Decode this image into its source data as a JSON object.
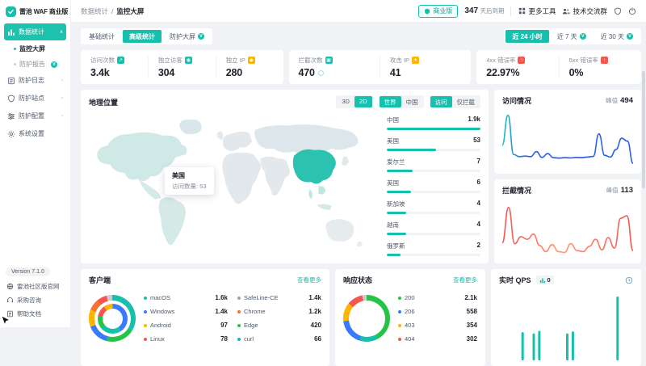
{
  "app": {
    "logo_text": "雷池 WAF 商业版",
    "version": "Version 7.1.0"
  },
  "sidebar": {
    "menu": [
      {
        "key": "data-stats",
        "label": "数据统计",
        "icon": "chart-icon",
        "active": true,
        "children": [
          {
            "key": "monitor-screen",
            "label": "监控大屏",
            "current": true
          },
          {
            "key": "protect-report",
            "label": "防护报告",
            "vip": true
          }
        ]
      },
      {
        "key": "protect-logs",
        "label": "防护日志",
        "icon": "log-icon",
        "chevron": true
      },
      {
        "key": "protect-sites",
        "label": "防护站点",
        "icon": "site-icon",
        "chevron": true
      },
      {
        "key": "protect-config",
        "label": "防护配置",
        "icon": "config-icon",
        "chevron": true
      },
      {
        "key": "system-settings",
        "label": "系统设置",
        "icon": "gear-icon"
      }
    ],
    "links": [
      {
        "key": "community-site",
        "label": "雷池社区版官网",
        "icon": "globe-icon"
      },
      {
        "key": "purchase",
        "label": "采购咨询",
        "icon": "headset-icon"
      },
      {
        "key": "help-docs",
        "label": "帮助文档",
        "icon": "doc-icon"
      }
    ]
  },
  "header": {
    "breadcrumb_parent": "数据统计",
    "breadcrumb_sep": "/",
    "breadcrumb_current": "监控大屏",
    "edition": "商业版",
    "expiry_days": "347",
    "expiry_suffix": "天后到期",
    "more_tools": "更多工具",
    "tech_group": "技术交流群"
  },
  "toolbar": {
    "tabs": [
      {
        "key": "basic-stats",
        "label": "基础统计"
      },
      {
        "key": "advanced-stats",
        "label": "高级统计",
        "active": true
      },
      {
        "key": "protect-screen",
        "label": "防护大屏",
        "vip": true
      }
    ],
    "ranges": [
      {
        "key": "24h",
        "label": "近 24 小时",
        "active": true
      },
      {
        "key": "7d",
        "label": "近 7 天",
        "vip": true
      },
      {
        "key": "30d",
        "label": "近 30 天",
        "vip": true
      }
    ]
  },
  "stats_cards": [
    {
      "items": [
        {
          "key": "visits",
          "label": "访问次数",
          "value": "3.4k",
          "icon_color": "#16c0ac",
          "glyph": "↗"
        },
        {
          "key": "unique-visitors",
          "label": "独立访客",
          "value": "304",
          "icon_color": "#16c0ac",
          "glyph": "◉"
        },
        {
          "key": "unique-ip",
          "label": "独立 IP",
          "value": "280",
          "icon_color": "#ffb400",
          "glyph": "◆"
        }
      ]
    },
    {
      "items": [
        {
          "key": "blocks",
          "label": "拦截次数",
          "value": "470",
          "icon_color": "#16c0ac",
          "glyph": "▣",
          "extra": "circle"
        },
        {
          "key": "attack-ip",
          "label": "攻击 IP",
          "value": "41",
          "icon_color": "#ffb400",
          "glyph": "✦"
        }
      ]
    },
    {
      "items": [
        {
          "key": "err-4xx",
          "label": "4xx 错误率",
          "value": "22.97%",
          "icon_color": "#f5564e",
          "glyph": "↑"
        },
        {
          "key": "err-5xx",
          "label": "5xx 错误率",
          "value": "0%",
          "icon_color": "#f5564e",
          "glyph": "↑"
        }
      ]
    }
  ],
  "geo": {
    "title": "地理位置",
    "toggle_groups": [
      {
        "key": "dimension",
        "options": [
          {
            "label": "3D"
          },
          {
            "label": "2D",
            "active": true
          }
        ]
      },
      {
        "key": "scope",
        "options": [
          {
            "label": "世界",
            "active": true
          },
          {
            "label": "中国"
          }
        ]
      },
      {
        "key": "mode",
        "options": [
          {
            "label": "访问",
            "active": true
          },
          {
            "label": "仅拦截"
          }
        ]
      }
    ],
    "tooltip": {
      "title": "美国",
      "line": "访问数量: 53"
    },
    "countries": [
      {
        "name": "中国",
        "display": "1.9k",
        "value": 1900
      },
      {
        "name": "美国",
        "display": "53",
        "value": 53
      },
      {
        "name": "爱尔兰",
        "display": "7",
        "value": 7
      },
      {
        "name": "英国",
        "display": "6",
        "value": 6
      },
      {
        "name": "新加坡",
        "display": "4",
        "value": 4
      },
      {
        "name": "越南",
        "display": "4",
        "value": 4
      },
      {
        "name": "俄罗斯",
        "display": "2",
        "value": 2
      }
    ]
  },
  "visits_chart": {
    "title": "访问情况",
    "peak_label": "峰值",
    "peak": "494",
    "ymax": 520,
    "values": [
      210,
      494,
      120,
      100,
      105,
      100,
      148,
      92,
      128,
      90,
      86,
      90,
      88,
      92,
      90,
      96,
      102,
      318,
      112,
      96,
      168,
      275,
      248,
      36
    ]
  },
  "blocks_chart": {
    "title": "拦截情况",
    "peak_label": "峰值",
    "peak": "113",
    "ymax": 125,
    "values": [
      32,
      113,
      30,
      46,
      40,
      52,
      26,
      12,
      28,
      12,
      10,
      30,
      14,
      12,
      24,
      40,
      16,
      44,
      20,
      88,
      94,
      14
    ]
  },
  "clients": {
    "title": "客户端",
    "more": "查看更多",
    "items": [
      {
        "name": "macOS",
        "display": "1.6k",
        "color": "#16c0ac"
      },
      {
        "name": "Windows",
        "display": "1.4k",
        "color": "#3a7afe"
      },
      {
        "name": "Android",
        "display": "97",
        "color": "#ffb400"
      },
      {
        "name": "Linux",
        "display": "78",
        "color": "#f5564e"
      },
      {
        "name": "SafeLine-CE",
        "display": "1.4k",
        "color": "#9fa6ad"
      },
      {
        "name": "Chrome",
        "display": "1.2k",
        "color": "#f77234"
      },
      {
        "name": "Edge",
        "display": "420",
        "color": "#27c346"
      },
      {
        "name": "curl",
        "display": "66",
        "color": "#0fb3d1"
      }
    ],
    "donut_outer": [
      {
        "color": "#16c0ac",
        "pct": 34
      },
      {
        "color": "#27c346",
        "pct": 20
      },
      {
        "color": "#3a7afe",
        "pct": 15
      },
      {
        "color": "#ffb400",
        "pct": 12
      },
      {
        "color": "#f77234",
        "pct": 8
      },
      {
        "color": "#f5564e",
        "pct": 7
      },
      {
        "color": "#c9cdd4",
        "pct": 4
      }
    ],
    "donut_inner": [
      {
        "color": "#3a7afe",
        "pct": 40
      },
      {
        "color": "#16c0ac",
        "pct": 24
      },
      {
        "color": "#27c346",
        "pct": 14
      },
      {
        "color": "#f5564e",
        "pct": 12
      },
      {
        "color": "#ffb400",
        "pct": 10
      }
    ]
  },
  "status": {
    "title": "响应状态",
    "more": "查看更多",
    "items": [
      {
        "code": "200",
        "value": "2.1k",
        "color": "#27c346"
      },
      {
        "code": "206",
        "value": "558",
        "color": "#3a7afe"
      },
      {
        "code": "403",
        "value": "354",
        "color": "#ffb400"
      },
      {
        "code": "404",
        "value": "302",
        "color": "#f5564e"
      }
    ],
    "donut": [
      {
        "color": "#27c346",
        "pct": 42
      },
      {
        "color": "#16c0ac",
        "pct": 13
      },
      {
        "color": "#3a7afe",
        "pct": 18
      },
      {
        "color": "#ffb400",
        "pct": 13
      },
      {
        "color": "#f5564e",
        "pct": 11
      },
      {
        "color": "#c9cdd4",
        "pct": 3
      }
    ]
  },
  "qps": {
    "title": "实时 QPS",
    "badge": "0",
    "color": "#16c0ac",
    "ymax": 100,
    "values": [
      0,
      0,
      0,
      0,
      42,
      0,
      40,
      44,
      0,
      0,
      0,
      0,
      40,
      43,
      0,
      0,
      0,
      0,
      0,
      0,
      0,
      95,
      0,
      0
    ]
  },
  "colors": {
    "brand": "#16c0ac",
    "blue": "#3a7afe",
    "red": "#f5564e",
    "yellow": "#ffb400",
    "green": "#27c346"
  }
}
